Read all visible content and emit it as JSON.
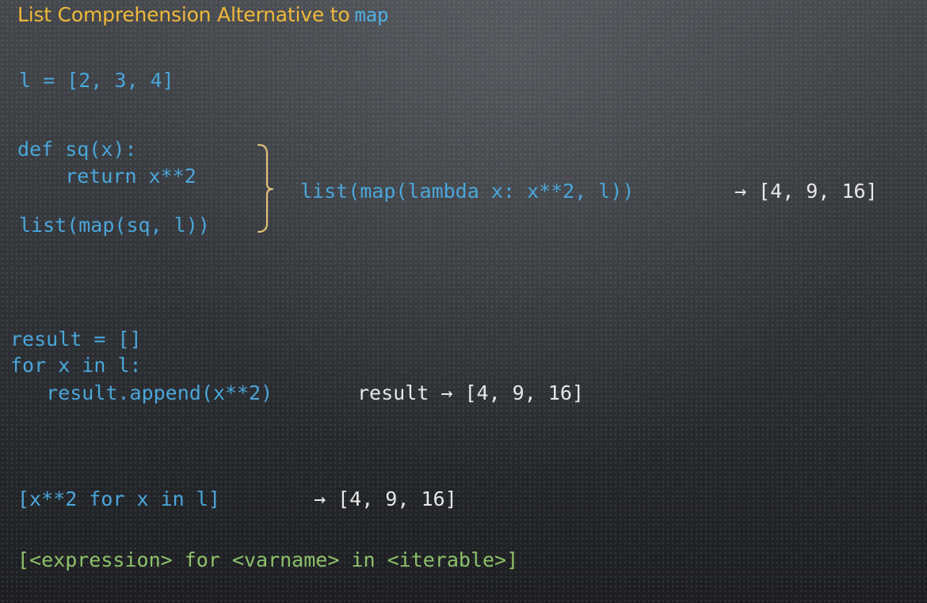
{
  "slide": {
    "title_text": "List Comprehension Alternative to",
    "title_keyword": "map",
    "line_l": "l = [2, 3, 4]",
    "def_line": "def sq(x):",
    "return_line": "    return x**2",
    "map_call": "list(map(sq, l))",
    "lambda_expr": "list(map(lambda x: x**2, l))",
    "lambda_result": "→ [4, 9, 16]",
    "result_init": "result = []",
    "for_line": "for x in l:",
    "append_line": "   result.append(x**2)",
    "result_arrow": "result → [4, 9, 16]",
    "comprehension": "[x**2 for x in l]",
    "comprehension_result": "→ [4, 9, 16]",
    "syntax_line": "[<expression> for <varname> in <iterable>]",
    "colors": {
      "title": "#f0b93a",
      "code": "#4aa6da",
      "output": "#e8e8e8",
      "syntax": "#8dc26a",
      "bracket": "#e0c07a"
    }
  }
}
